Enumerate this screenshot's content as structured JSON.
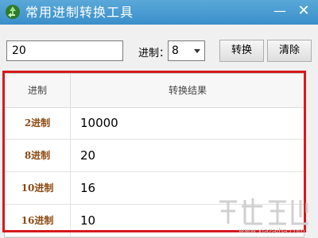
{
  "window": {
    "title": "常用进制转换工具",
    "minimize_glyph": "—",
    "close_glyph": "✕",
    "app_icon": "recycle-arrows-icon"
  },
  "input": {
    "value": "20"
  },
  "base_selector": {
    "label": "进制：",
    "value": "8"
  },
  "buttons": {
    "convert": "转换",
    "clear": "清除"
  },
  "table": {
    "headers": {
      "base": "进制",
      "result": "转换结果"
    },
    "rows": [
      {
        "base": "2进制",
        "value": "10000"
      },
      {
        "base": "8进制",
        "value": "20"
      },
      {
        "base": "10进制",
        "value": "16"
      },
      {
        "base": "16进制",
        "value": "10"
      }
    ]
  },
  "colors": {
    "titlebar": "#3a8fca",
    "highlight_border": "#d7191c",
    "base_text": "#8b4a12"
  },
  "watermark": {
    "text": "www.xiazaiba.com"
  }
}
